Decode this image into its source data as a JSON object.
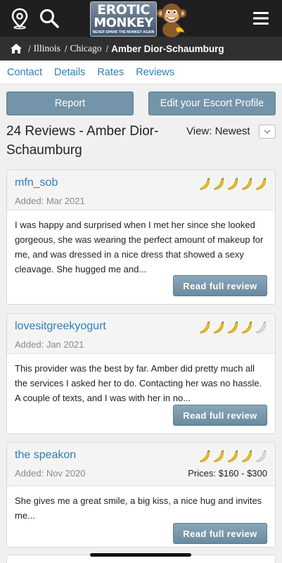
{
  "header": {
    "logo_line1": "EROTIC",
    "logo_line2": "MONKEY",
    "logo_tagline": "NEVER SPANK THE MONKEY AGAIN"
  },
  "breadcrumb": {
    "sep": "/",
    "items": [
      "Illinois",
      "Chicago"
    ],
    "current": "Amber Dior-Schaumburg"
  },
  "tabs": [
    "Contact",
    "Details",
    "Rates",
    "Reviews"
  ],
  "actions": {
    "report": "Report",
    "edit_profile": "Edit your Escort Profile"
  },
  "heading": {
    "title": "24 Reviews - Amber Dior-Schaumburg",
    "view_label": "View: Newest"
  },
  "read_full_review": "Read full review",
  "reviews": [
    {
      "user": "mfn_sob",
      "added": "Added: Mar 2021",
      "rating": 5,
      "text": "I was happy and surprised when I met her since she looked gorgeous, she was wearing the perfect amount of makeup for me, and was dressed in a nice dress that showed a sexy cleavage. She hugged me and..."
    },
    {
      "user": "lovesitgreekyogurt",
      "added": "Added: Jan 2021",
      "rating": 4,
      "text": "This provider was the best by far. Amber did pretty much all the services I asked her to do. Contacting her was no hassle. A couple of texts, and I was with her in no..."
    },
    {
      "user": "the speakon",
      "added": "Added: Nov 2020",
      "rating": 4,
      "prices": "Prices: $160 - $300",
      "text": "She gives me a great smile, a big kiss, a nice hug and invites me..."
    }
  ],
  "colors": {
    "link": "#2f7fb6",
    "button": "#7394a9",
    "banana_full": "#f2c81a",
    "banana_empty": "#e2e2e2"
  }
}
